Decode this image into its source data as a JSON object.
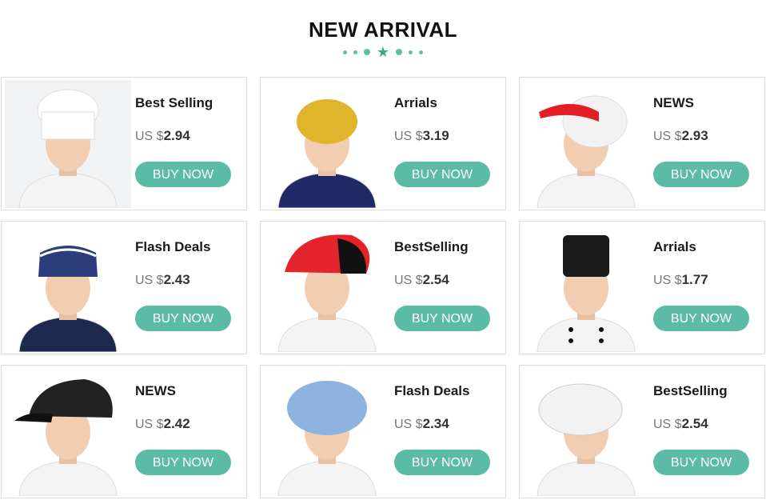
{
  "header": {
    "title": "NEW ARRIVAL"
  },
  "price_prefix": "US $",
  "buy_label": "BUY NOW",
  "colors": {
    "accent": "#5bbba4"
  },
  "products": [
    {
      "title": "Best Selling",
      "price": "2.94",
      "hat_color": "#ffffff",
      "image": "white-chef-toque"
    },
    {
      "title": "Arrials",
      "price": "3.19",
      "hat_color": "#e0b52c",
      "image": "yellow-scrub-cap"
    },
    {
      "title": "NEWS",
      "price": "2.93",
      "hat_color": "#e21f26",
      "image": "red-visor-cap"
    },
    {
      "title": "Flash Deals",
      "price": "2.43",
      "hat_color": "#2b3d7a",
      "image": "navy-garrison-cap"
    },
    {
      "title": "BestSelling",
      "price": "2.54",
      "hat_color": "#e3252b",
      "image": "red-black-beret"
    },
    {
      "title": "Arrials",
      "price": "1.77",
      "hat_color": "#1a1a1a",
      "image": "black-chef-hat"
    },
    {
      "title": "NEWS",
      "price": "2.42",
      "hat_color": "#222222",
      "image": "black-newsboy-cap"
    },
    {
      "title": "Flash Deals",
      "price": "2.34",
      "hat_color": "#8fb3e0",
      "image": "blue-bouffant-cap"
    },
    {
      "title": "BestSelling",
      "price": "2.54",
      "hat_color": "#f2f2f2",
      "image": "white-mesh-cap"
    }
  ]
}
